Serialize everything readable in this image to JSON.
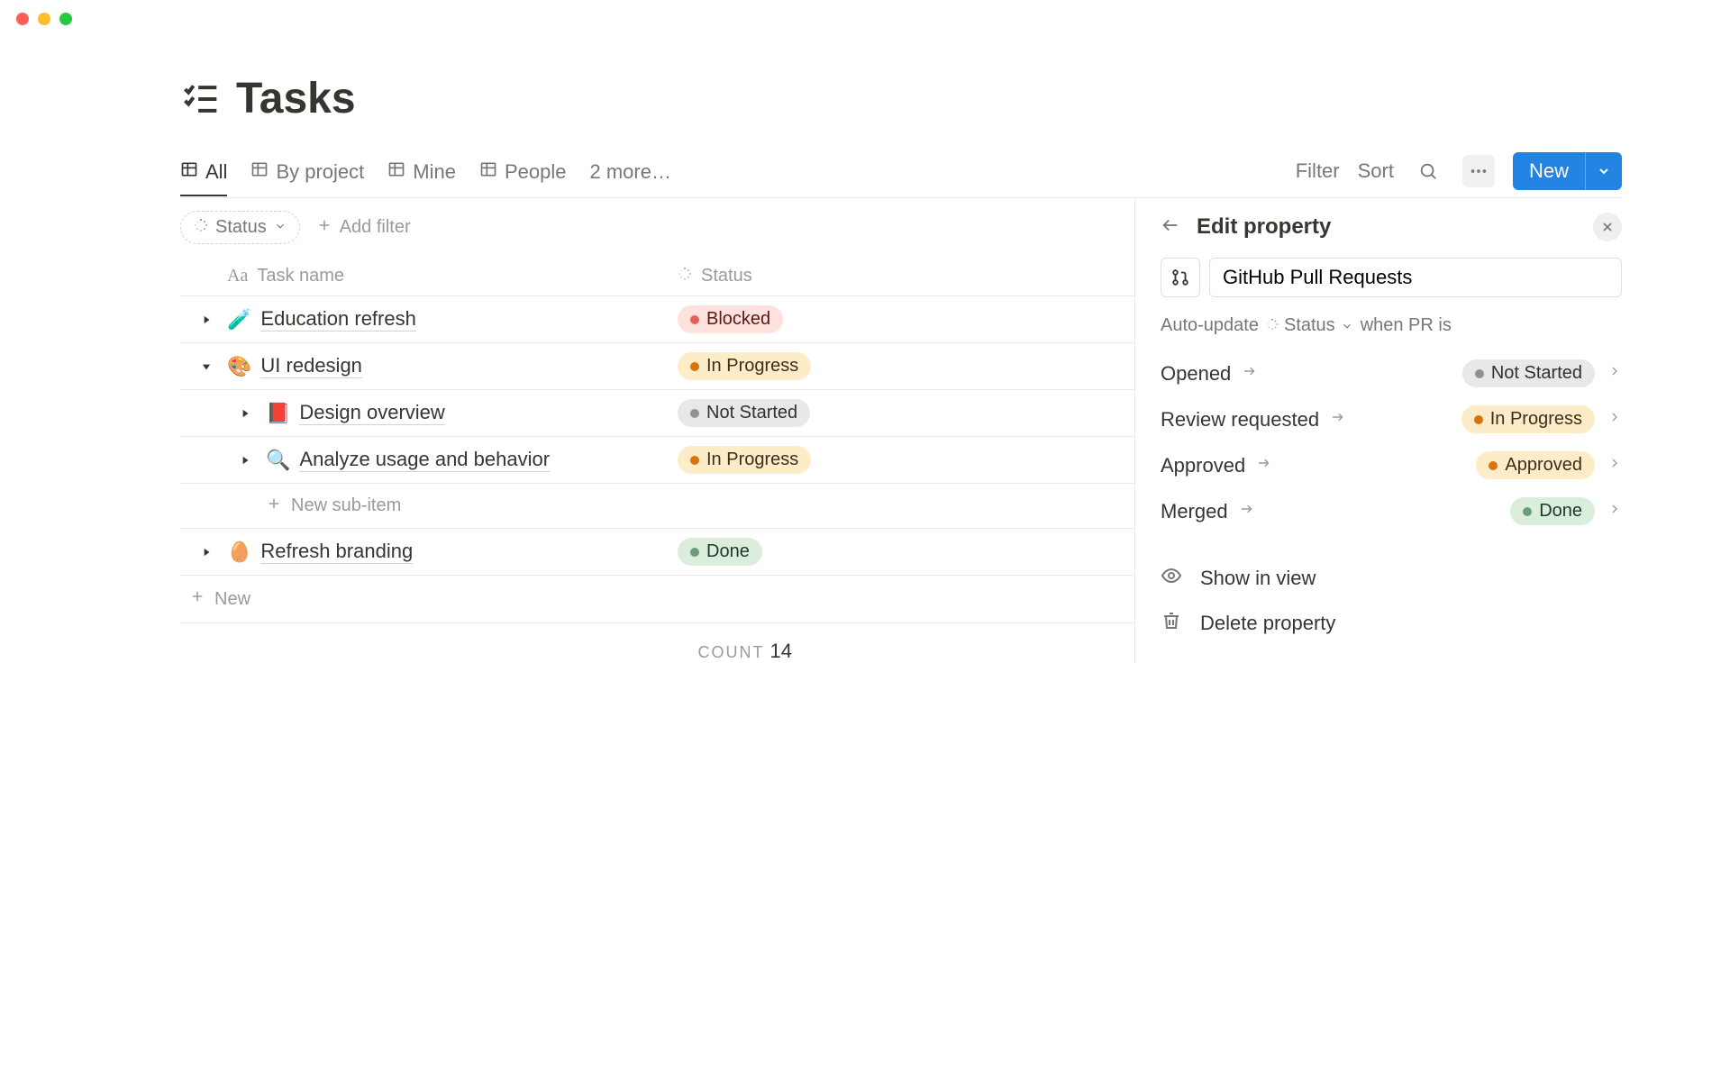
{
  "header": {
    "title": "Tasks"
  },
  "views": {
    "tabs": [
      {
        "label": "All"
      },
      {
        "label": "By project"
      },
      {
        "label": "Mine"
      },
      {
        "label": "People"
      }
    ],
    "more": "2 more…"
  },
  "toolbar": {
    "filter": "Filter",
    "sort": "Sort",
    "new": "New"
  },
  "filters": {
    "status_label": "Status",
    "add_filter": "Add filter"
  },
  "columns": {
    "name": "Task name",
    "status": "Status"
  },
  "rows": [
    {
      "emoji": "🧪",
      "title": "Education refresh",
      "status": "Blocked",
      "expanded": false,
      "indent": 0
    },
    {
      "emoji": "🎨",
      "title": "UI redesign",
      "status": "In Progress",
      "expanded": true,
      "indent": 0
    },
    {
      "emoji": "📕",
      "title": "Design overview",
      "status": "Not Started",
      "expanded": false,
      "indent": 1
    },
    {
      "emoji": "🔍",
      "title": "Analyze usage and behavior",
      "status": "In Progress",
      "expanded": false,
      "indent": 1
    },
    {
      "emoji": "🥚",
      "title": "Refresh branding",
      "status": "Done",
      "expanded": false,
      "indent": 0
    }
  ],
  "new_subitem": "New sub-item",
  "new_row": "New",
  "count": {
    "label": "COUNT",
    "value": "14"
  },
  "panel": {
    "title": "Edit property",
    "property_name": "GitHub Pull Requests",
    "auto_update_prefix": "Auto-update",
    "auto_update_target": "Status",
    "auto_update_suffix": "when PR is",
    "mappings": [
      {
        "from": "Opened",
        "to": "Not Started",
        "pill": "notstarted"
      },
      {
        "from": "Review requested",
        "to": "In Progress",
        "pill": "inprogress"
      },
      {
        "from": "Approved",
        "to": "Approved",
        "pill": "approved"
      },
      {
        "from": "Merged",
        "to": "Done",
        "pill": "done"
      }
    ],
    "actions": {
      "show_in_view": "Show in view",
      "delete": "Delete property"
    }
  }
}
